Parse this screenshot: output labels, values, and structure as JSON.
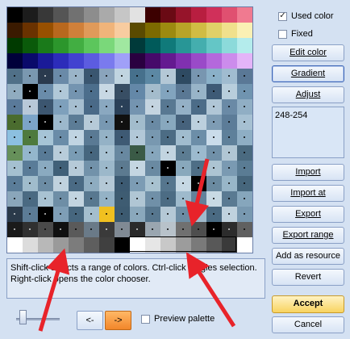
{
  "checkboxes": {
    "used_color": {
      "label": "Used color",
      "checked": true
    },
    "fixed": {
      "label": "Fixed",
      "checked": false
    }
  },
  "buttons": {
    "edit_color": "Edit color",
    "gradient": "Gradient",
    "adjust": "Adjust",
    "import": "Import",
    "import_at": "Import at",
    "export": "Export",
    "export_range": "Export range",
    "add_as_resource": "Add as resource",
    "revert": "Revert",
    "accept": "Accept",
    "cancel": "Cancel"
  },
  "selection_range": "248-254",
  "hint_text": "Shift-click selects a range of colors. Ctrl-click toggles selection.\nRight-click opens the color chooser.",
  "nav": {
    "prev": "<-",
    "next": "->"
  },
  "preview_palette": {
    "label": "Preview palette",
    "checked": false
  },
  "annotation_color": "#e8232a",
  "palette": [
    [
      "#000000",
      "#1c1c1c",
      "#383838",
      "#555555",
      "#717171",
      "#8d8d8d",
      "#aaaaaa",
      "#c6c6c6",
      "#e2e2e2",
      "#3c0000",
      "#6a0a14",
      "#96142a",
      "#b81e40",
      "#d0305a",
      "#e05070",
      "#f07a90"
    ],
    [
      "#3a1a00",
      "#6a3200",
      "#985000",
      "#b8681e",
      "#d0803a",
      "#e09a5a",
      "#f0b47a",
      "#f8cca0",
      "#5a4a00",
      "#7c6a00",
      "#9c8a10",
      "#b8a428",
      "#d0bc44",
      "#e0d068",
      "#f0e08c",
      "#faf0b4"
    ],
    [
      "#003a00",
      "#0a5a0a",
      "#1a7a1a",
      "#2c962c",
      "#42ae42",
      "#5cc65c",
      "#7ad87a",
      "#a0e8a0",
      "#003a3a",
      "#005a5a",
      "#107a7a",
      "#289696",
      "#44aeae",
      "#64c6c6",
      "#8cdada",
      "#b4ecec"
    ],
    [
      "#00003a",
      "#0a0a6a",
      "#1a1a98",
      "#2c2cba",
      "#4242d0",
      "#5c5ce0",
      "#7a7aee",
      "#a0a0f8",
      "#2a0040",
      "#460a6a",
      "#641a90",
      "#8030b0",
      "#9a4ac8",
      "#b468dc",
      "#cc8cec",
      "#e4b4f8"
    ],
    [
      "#507088",
      "#7a98b0",
      "#2a3a4e",
      "#6a8aa8",
      "#9ab4c8",
      "#3a5670",
      "#8aa4bc",
      "#c0d4e0",
      "#46708c",
      "#5c88a4",
      "#b4c8d6",
      "#2e4a62",
      "#7896b0",
      "#8ab0c8",
      "#a0bcd0",
      "#5a7896"
    ],
    [
      "#90acc0",
      "#000000",
      "#6a8caa",
      "#b0c8d8",
      "#7494b0",
      "#4c6e8c",
      "#c8d8e4",
      "#384e64",
      "#6488a8",
      "#a4bccc",
      "#82a4be",
      "#5a7894",
      "#98b4c8",
      "#3e5a76",
      "#b8cedc",
      "#7094b0"
    ],
    [
      "#5a7a9a",
      "#b8c8d8",
      "#3c5670",
      "#7ea0bc",
      "#a6bed0",
      "#4a6a88",
      "#8aa8c0",
      "#2a4058",
      "#7494b0",
      "#c4d4e0",
      "#587892",
      "#94b0c6",
      "#4c6c88",
      "#b0c6d6",
      "#6a8aa6",
      "#90aec4"
    ],
    [
      "#4a6c2e",
      "#7ca4c8",
      "#000000",
      "#9cb8cc",
      "#5c7c96",
      "#b6cad8",
      "#7898b2",
      "#101010",
      "#a2bccc",
      "#6a8aa4",
      "#88a8be",
      "#46627c",
      "#bcd0de",
      "#7e9cb4",
      "#5c7c98",
      "#a6c0d2"
    ],
    [
      "#8cc0e0",
      "#4e7a3e",
      "#a6c4d6",
      "#6a8ca8",
      "#c0d4e2",
      "#5a7a94",
      "#94b2c6",
      "#3e5a74",
      "#b2c8d8",
      "#7898b0",
      "#4c6c84",
      "#a0bcce",
      "#6c8ea8",
      "#cadcea",
      "#5e809a",
      "#8eaec4"
    ],
    [
      "#66905a",
      "#94b6cc",
      "#587a96",
      "#b8ccda",
      "#7a9cb4",
      "#46667e",
      "#a8c2d2",
      "#6888a0",
      "#3a5a46",
      "#86a6bc",
      "#c2d4e0",
      "#5c7c92",
      "#9cbace",
      "#7090a8",
      "#b0c6d4",
      "#4a6a80"
    ],
    [
      "#a4c0d0",
      "#5a7c98",
      "#8aaac0",
      "#406078",
      "#b6cad8",
      "#7292aa",
      "#9cb8ca",
      "#5c7a90",
      "#c4d6e2",
      "#6a8aa2",
      "#000000",
      "#88a8bc",
      "#4e6e86",
      "#acc4d2",
      "#7a9ab2",
      "#5a7c94"
    ],
    [
      "#5a7c98",
      "#a0bccc",
      "#6c8ca4",
      "#c0d2de",
      "#4a6a84",
      "#8eacc0",
      "#b4c8d6",
      "#3c5a72",
      "#7c9cb4",
      "#a8c2d0",
      "#56768e",
      "#c6d8e4",
      "#000000",
      "#6a8aa0",
      "#98b6c8",
      "#46667c"
    ],
    [
      "#8aa6ba",
      "#4a6a82",
      "#a8c2d2",
      "#6e8ea6",
      "#c2d4e0",
      "#587890",
      "#94b2c6",
      "#3e5c72",
      "#b0c6d4",
      "#7090a8",
      "#4c6c84",
      "#9ebacc",
      "#62829a",
      "#c8dae4",
      "#5a7a92",
      "#86a6bc"
    ],
    [
      "#2a3a4a",
      "#5c7c96",
      "#000000",
      "#7e9eb6",
      "#46667e",
      "#a4bece",
      "#f0c020",
      "#3c5a70",
      "#8aa8bc",
      "#56768e",
      "#b4c8d6",
      "#6c8ca4",
      "#a0bacc",
      "#4a6a82",
      "#c0d2de",
      "#7898b0"
    ],
    [
      "#1a1a1a",
      "#303030",
      "#4a4a4a",
      "#101010",
      "#5a5a5a",
      "#6a7a88",
      "#3a3a3a",
      "#808a94",
      "#2a2a2a",
      "#9aa6b0",
      "#b8c2ca",
      "#707070",
      "#4e4e4e",
      "#000000",
      "#2c2c2c",
      "#606060"
    ],
    [
      "#ffffff",
      "#dcdcdc",
      "#b8b8b8",
      "#9a9a9a",
      "#7c7c7c",
      "#5e5e5e",
      "#404040",
      "#000000",
      "#ffffff",
      "#e6e6e6",
      "#c8c8c8",
      "#9c9c9c",
      "#7a7a7a",
      "#585858",
      "#3a3a3a",
      "#ffffff"
    ]
  ]
}
